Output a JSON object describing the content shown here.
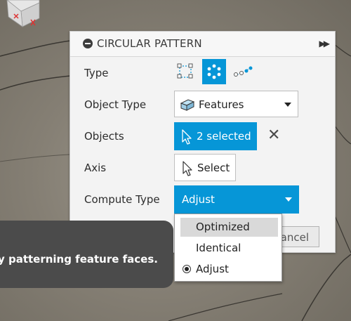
{
  "panel": {
    "title": "CIRCULAR PATTERN",
    "rows": {
      "type_label": "Type",
      "object_type_label": "Object Type",
      "objects_label": "Objects",
      "axis_label": "Axis",
      "compute_type_label": "Compute Type"
    },
    "type_options": [
      {
        "icon": "faces-pattern-icon",
        "selected": false
      },
      {
        "icon": "features-pattern-icon",
        "selected": true
      },
      {
        "icon": "bodies-pattern-icon",
        "selected": false
      }
    ],
    "object_type": {
      "value": "Features",
      "icon": "feature-solid-icon"
    },
    "objects": {
      "value": "2 selected",
      "icon": "cursor-arrow-icon"
    },
    "axis": {
      "value": "Select",
      "icon": "cursor-arrow-icon"
    },
    "compute_type": {
      "value": "Adjust"
    },
    "cancel_label": "ancel"
  },
  "compute_menu": {
    "items": [
      {
        "label": "Optimized",
        "highlighted": true
      },
      {
        "label": "Identical",
        "highlighted": false
      },
      {
        "label": "Adjust",
        "checked": true
      }
    ]
  },
  "tooltip": {
    "text": "y patterning feature faces."
  },
  "colors": {
    "accent": "#0696d7",
    "panel_bg": "#f3f3f3",
    "tooltip_bg": "#4b4b4b"
  }
}
